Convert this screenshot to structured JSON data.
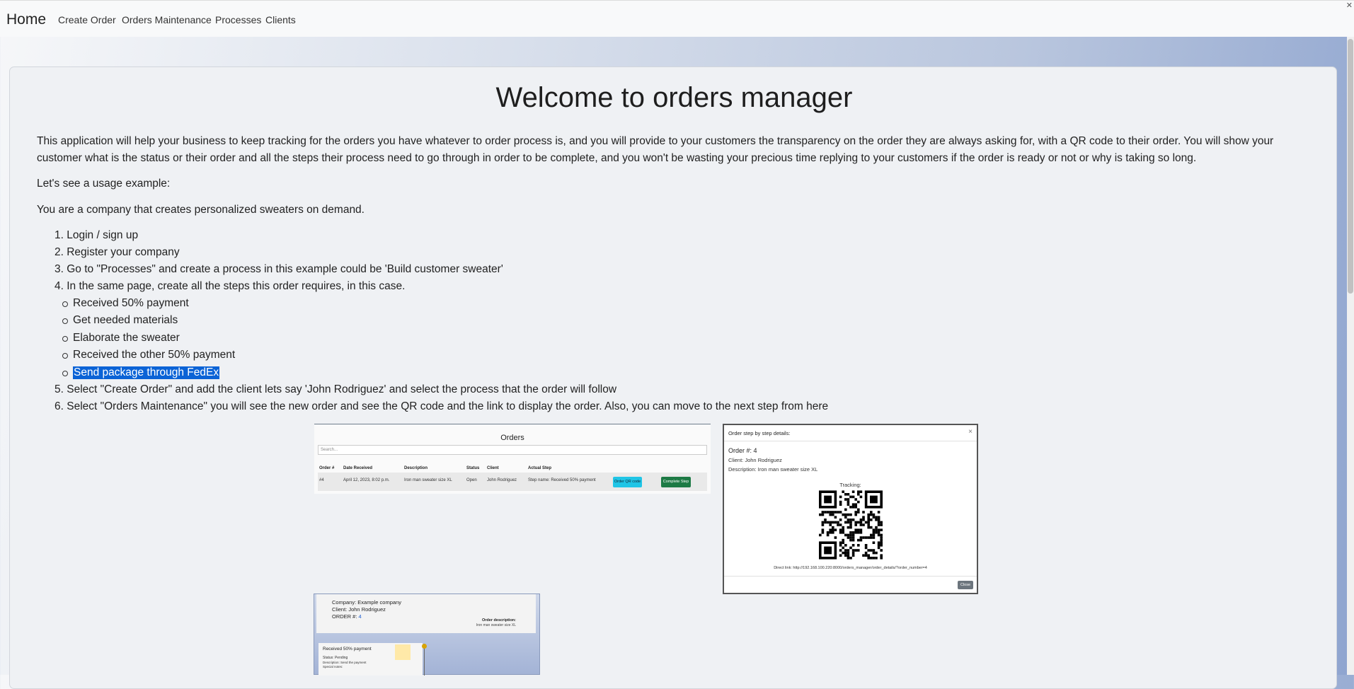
{
  "navbar": {
    "brand": "Home",
    "links": [
      "Create Order",
      "Orders Maintenance",
      "Processes",
      "Clients"
    ]
  },
  "main": {
    "title": "Welcome to orders manager",
    "intro": "This application will help your business to keep tracking for the orders you have whatever to order process is, and you will provide to your customers the transparency on the order they are always asking for, with a QR code to their order. You will show your customer what is the status or their order and all the steps their process need to go through in order to be complete, and you won't be wasting your precious time replying to your customers if the order is ready or not or why is taking so long.",
    "usage_heading": "Let's see a usage example:",
    "scenario": "You are a company that creates personalized sweaters on demand.",
    "steps": [
      "1. Login / sign up",
      "2. Register your company",
      "3. Go to \"Processes\" and create a process in this example could be 'Build customer sweater'",
      "4. In the same page, create all the steps this order requires, in this case.",
      "5. Select \"Create Order\" and add the client lets say 'John Rodriguez' and select the process that the order will follow",
      "6. Select \"Orders Maintenance\" you will see the new order and see the QR code and the link to display the order. Also, you can move to the next step from here"
    ],
    "substeps": [
      "Received 50% payment",
      "Get needed materials",
      "Elaborate the sweater",
      "Received the other 50% payment",
      "Send package through FedEx"
    ]
  },
  "orders_shot": {
    "title": "Orders",
    "search_placeholder": "Search...",
    "headers": [
      "Order #",
      "Date Received",
      "Description",
      "Status",
      "Client",
      "Actual Step"
    ],
    "row": [
      "#4",
      "April 12, 2023, 8:02 p.m.",
      "Iron man sweater size XL",
      "Open",
      "John Rodriguez",
      "Step name: Received 50% payment"
    ],
    "qr_button": "Order QR code",
    "complete_button": "Complete Step"
  },
  "modal_shot": {
    "header": "Order step by step details:",
    "close_x": "×",
    "order": "Order #: 4",
    "client": "Client: John Rodriguez",
    "description": "Description: Iron man sweater size XL",
    "tracking": "Tracking:",
    "direct_link": "Direct link: http://192.168.100.220:8000/orders_manager/order_details/?order_number=4",
    "close": "Close"
  },
  "tracking_shot": {
    "company": "Company: Example company",
    "client": "Client: John Rodriguez",
    "order_label": "ORDER #: ",
    "order_number": "4",
    "order_desc_label": "Order description:",
    "order_desc": "Iron man sweater size XL",
    "step_title": "Received 50% payment",
    "step_status": "Status: Pending",
    "step_desc": "Description: Send the payment",
    "step_notes": "Special notes:"
  }
}
